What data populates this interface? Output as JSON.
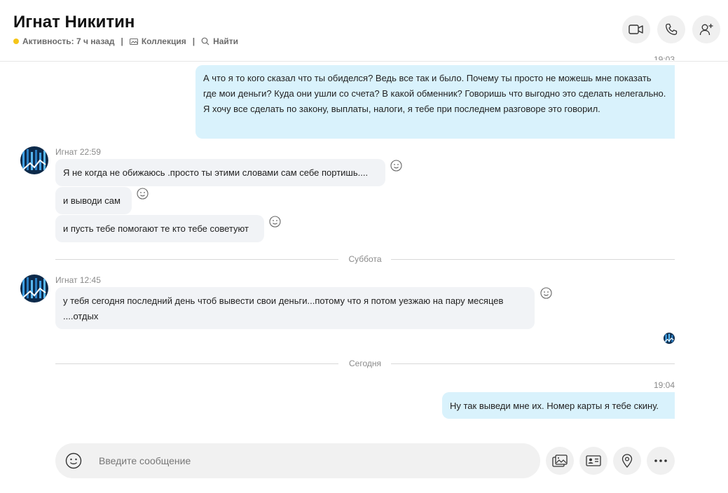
{
  "header": {
    "contact_name": "Игнат Никитин",
    "status": "Активность: 7 ч назад",
    "gallery": "Коллекция",
    "find": "Найти",
    "divider": "|"
  },
  "conversation": {
    "partial_time": "19:03",
    "outgoing_1": "А что я то кого сказал что ты обиделся? Ведь все так и было. Почему ты просто не можешь мне показать где мои деньги? Куда они ушли со счета? В какой обменник? Говоришь что выгодно это сделать нелегально. Я хочу все сделать по закону, выплаты, налоги, я тебе при последнем разговоре это говорил.",
    "group1_meta": "Игнат 22:59",
    "incoming_1": "Я не когда не обижаюсь .просто ты этими словами сам себе портишь....",
    "incoming_2": "и выводи сам",
    "incoming_3": "и пусть тебе помогают те кто тебе советуют",
    "day_saturday": "Суббота",
    "group2_meta": "Игнат 12:45",
    "incoming_4_line1": "у тебя сегодня последний день чтоб вывести свои деньги...потому что я потом уезжаю на пару месяцев",
    "incoming_4_line2": "....отдых",
    "day_today": "Сегодня",
    "outgoing_2_time": "19:04",
    "outgoing_2": "Ну так выведи мне их. Номер карты я тебе скину."
  },
  "composer": {
    "placeholder": "Введите сообщение"
  },
  "colors": {
    "outgoing_bubble": "#d9f2fc",
    "incoming_bubble": "#f1f3f6",
    "status_dot": "#f5c518"
  },
  "icons": [
    "video-call-icon",
    "phone-icon",
    "add-person-icon",
    "emoji-icon",
    "media-icon",
    "contact-card-icon",
    "location-icon",
    "more-icon",
    "smiley-reaction-icon",
    "gallery-icon",
    "search-icon"
  ]
}
